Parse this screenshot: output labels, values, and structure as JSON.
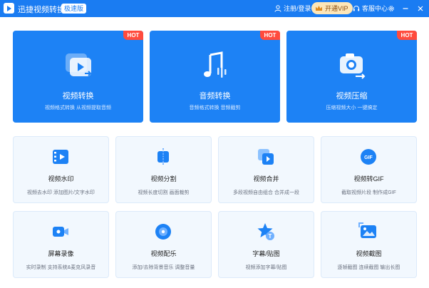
{
  "titlebar": {
    "app_title": "迅捷视频转换器",
    "edition_badge": "极速版",
    "login_label": "注册/登录",
    "vip_label": "开通VIP",
    "service_label": "客服中心"
  },
  "big_cards": [
    {
      "title": "视频转换",
      "subtitle": "视频格式转换 从视频提取音频",
      "badge": "HOT"
    },
    {
      "title": "音频转换",
      "subtitle": "音频格式转换 音频截剪",
      "badge": "HOT"
    },
    {
      "title": "视频压缩",
      "subtitle": "压缩视频大小 一键搞定",
      "badge": "HOT"
    }
  ],
  "small_cards": [
    {
      "title": "视频水印",
      "subtitle": "视频去水印 添加图片/文字水印"
    },
    {
      "title": "视频分割",
      "subtitle": "视频长度切割 画面裁剪"
    },
    {
      "title": "视频合并",
      "subtitle": "多段视频自由组合 合并成一段"
    },
    {
      "title": "视频转GIF",
      "subtitle": "截取视频片段 制作成GIF"
    },
    {
      "title": "屏幕录像",
      "subtitle": "实时录制 支持系统&麦克风录音"
    },
    {
      "title": "视频配乐",
      "subtitle": "添加/去除背景音乐 调整音量"
    },
    {
      "title": "字幕/贴图",
      "subtitle": "视频添加字幕/贴图"
    },
    {
      "title": "视频截图",
      "subtitle": "逐帧截图 连续截图 输出长图"
    }
  ],
  "icons": {
    "gif_text": "GIF",
    "subtitle_text": "T"
  },
  "colors": {
    "titlebar": "#1a7cf2",
    "big_card": "#1d82f5",
    "hot_badge": "#ff4b3d",
    "small_card_bg": "#f2f8fe",
    "vip_bg": "#fde6b8"
  }
}
